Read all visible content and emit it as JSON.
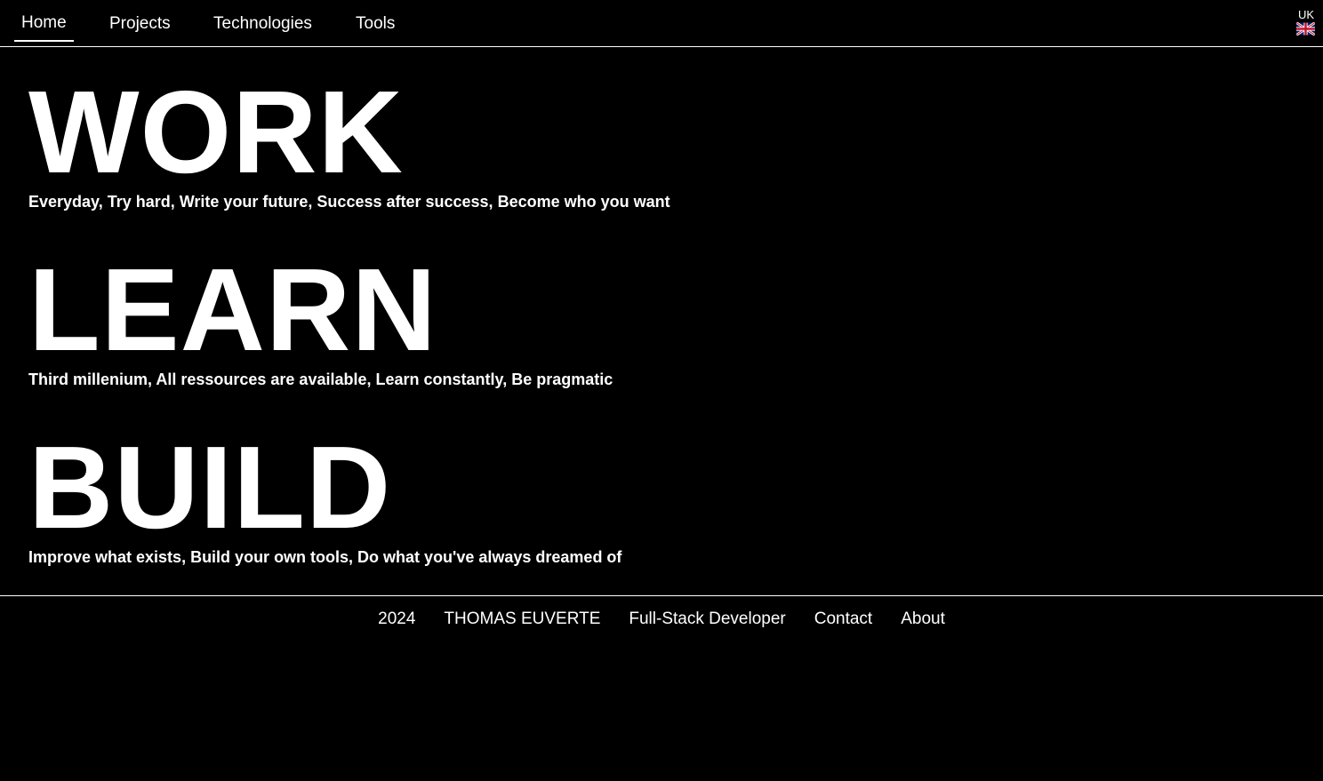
{
  "nav": {
    "items": [
      {
        "label": "Home",
        "active": true
      },
      {
        "label": "Projects",
        "active": false
      },
      {
        "label": "Technologies",
        "active": false
      },
      {
        "label": "Tools",
        "active": false
      }
    ],
    "language": {
      "code": "UK",
      "icon": "uk-flag-icon"
    }
  },
  "sections": [
    {
      "title": "WORK",
      "text": "Everyday, Try hard, Write your future, Success after success, Become who you want"
    },
    {
      "title": "LEARN",
      "text": "Third millenium, All ressources are available, Learn constantly, Be pragmatic"
    },
    {
      "title": "BUILD",
      "text": "Improve what exists, Build your own tools, Do what you've always dreamed of"
    }
  ],
  "footer": {
    "year": "2024",
    "name": "THOMAS EUVERTE",
    "role": "Full-Stack Developer",
    "contact": "Contact",
    "about": "About"
  },
  "colors": {
    "background": "#000000",
    "text": "#ffffff"
  }
}
